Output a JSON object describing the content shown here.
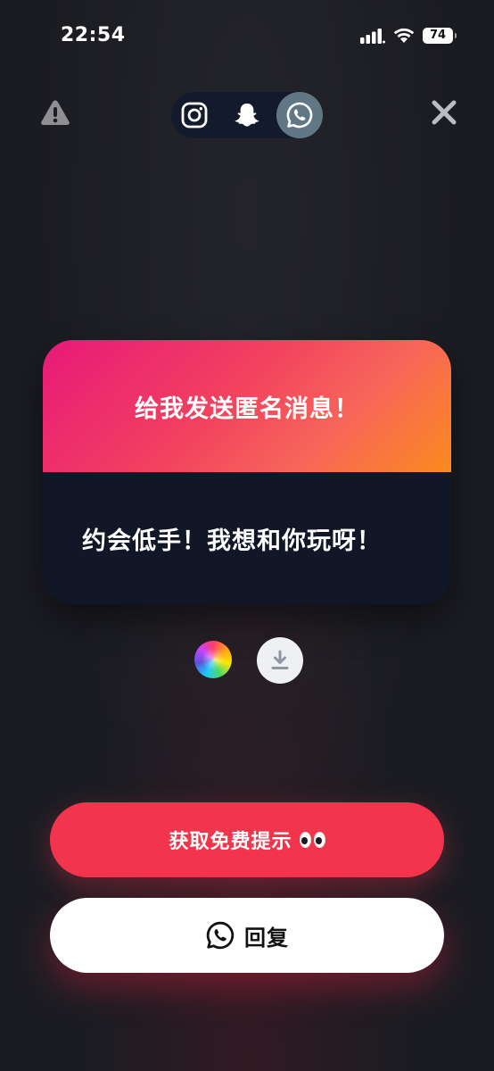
{
  "status_bar": {
    "time": "22:54",
    "battery": "74",
    "icons": [
      "cellular-signal-icon",
      "wifi-icon",
      "battery-icon"
    ]
  },
  "toolbar": {
    "report_icon": "warning-icon",
    "close_icon": "close-icon",
    "share_targets": [
      {
        "id": "instagram",
        "icon": "instagram-icon",
        "selected": false
      },
      {
        "id": "snapchat",
        "icon": "snapchat-ghost-icon",
        "selected": false
      },
      {
        "id": "whatsapp",
        "icon": "whatsapp-icon",
        "selected": true
      }
    ]
  },
  "card": {
    "header": "给我发送匿名消息！",
    "message": "约会低手！我想和你玩呀！",
    "header_gradient": [
      "#e8197a",
      "#f2425e",
      "#fb8a1e"
    ],
    "body_color": "#121728"
  },
  "tools": {
    "color_icon": "color-palette-icon",
    "download_icon": "download-icon"
  },
  "buttons": {
    "hint_label": "获取免费提示",
    "hint_emoji": "eyes-emoji-icon",
    "reply_label": "回复",
    "reply_icon": "whatsapp-icon"
  },
  "colors": {
    "background": "#1b1c22",
    "accent": "#f2344d",
    "selected_share": "#617884"
  }
}
